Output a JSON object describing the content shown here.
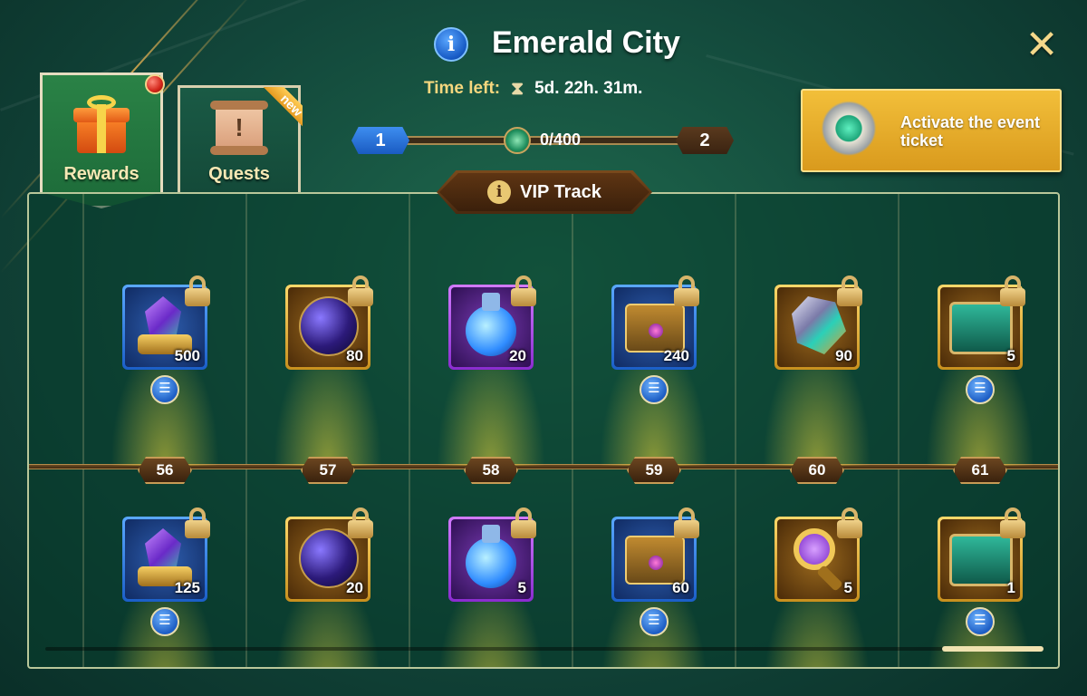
{
  "header": {
    "title": "Emerald City",
    "time_label": "Time left:",
    "time_value": "5d. 22h. 31m.",
    "close_glyph": "✕"
  },
  "progress": {
    "current_level": "1",
    "next_level": "2",
    "text": "0/400",
    "fraction": 0
  },
  "activate": {
    "label": "Activate the event ticket"
  },
  "tabs": [
    {
      "label": "Rewards",
      "selected": true,
      "notification": true
    },
    {
      "label": "Quests",
      "selected": false,
      "ribbon": "new"
    }
  ],
  "track": {
    "title": "VIP Track",
    "levels": [
      "56",
      "57",
      "58",
      "59",
      "60",
      "61"
    ],
    "top_row": [
      {
        "qty": "500",
        "frame": "blue",
        "icon": "crystal-icon",
        "locked": true,
        "list": true
      },
      {
        "qty": "80",
        "frame": "gold",
        "icon": "orb-icon",
        "locked": true,
        "list": false
      },
      {
        "qty": "20",
        "frame": "purple",
        "icon": "potion-icon",
        "locked": true,
        "list": false
      },
      {
        "qty": "240",
        "frame": "blue",
        "icon": "chest-icon",
        "locked": true,
        "list": true
      },
      {
        "qty": "90",
        "frame": "gold",
        "icon": "shard-icon",
        "locked": true,
        "list": false
      },
      {
        "qty": "5",
        "frame": "gold",
        "icon": "teal-chest-icon",
        "locked": true,
        "list": true
      }
    ],
    "bottom_row": [
      {
        "qty": "125",
        "frame": "blue",
        "icon": "crystal-icon",
        "locked": true,
        "list": true
      },
      {
        "qty": "20",
        "frame": "gold",
        "icon": "orb-icon",
        "locked": true,
        "list": false
      },
      {
        "qty": "5",
        "frame": "purple",
        "icon": "potion-icon",
        "locked": true,
        "list": false
      },
      {
        "qty": "60",
        "frame": "blue",
        "icon": "chest-icon",
        "locked": true,
        "list": true
      },
      {
        "qty": "5",
        "frame": "gold",
        "icon": "magnifier-icon",
        "locked": true,
        "list": false
      },
      {
        "qty": "1",
        "frame": "gold",
        "icon": "teal-chest-icon",
        "locked": true,
        "list": true
      }
    ]
  },
  "colors": {
    "accent_gold": "#f2bf3a",
    "background": "#12463a",
    "progress_blue": "#3e8ef0"
  }
}
